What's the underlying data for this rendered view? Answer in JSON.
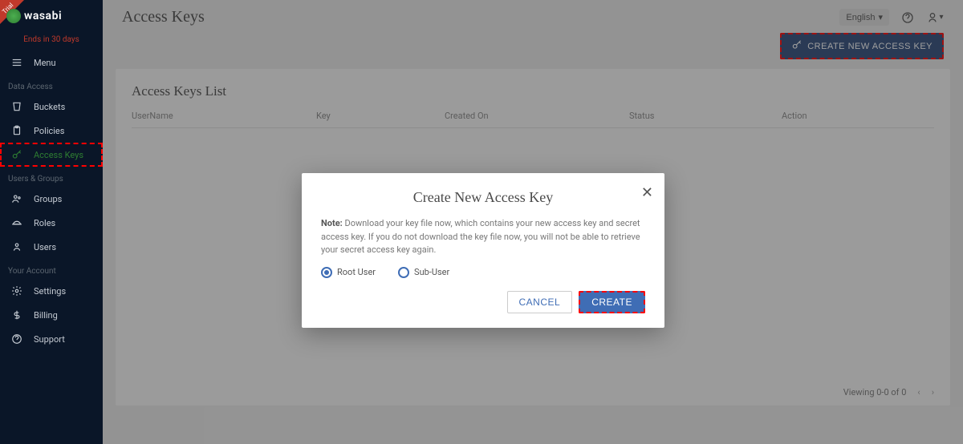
{
  "brand": {
    "name": "wasabi",
    "trial_ribbon": "Trial",
    "trial_ends": "Ends in 30 days"
  },
  "sidebar": {
    "menu_label": "Menu",
    "sections": {
      "data_access": {
        "label": "Data Access",
        "items": [
          {
            "label": "Buckets"
          },
          {
            "label": "Policies"
          },
          {
            "label": "Access Keys"
          }
        ]
      },
      "users_groups": {
        "label": "Users & Groups",
        "items": [
          {
            "label": "Groups"
          },
          {
            "label": "Roles"
          },
          {
            "label": "Users"
          }
        ]
      },
      "your_account": {
        "label": "Your Account",
        "items": [
          {
            "label": "Settings"
          },
          {
            "label": "Billing"
          },
          {
            "label": "Support"
          }
        ]
      }
    }
  },
  "header": {
    "page_title": "Access Keys",
    "language": "English",
    "create_button": "CREATE NEW ACCESS KEY"
  },
  "list": {
    "title": "Access Keys List",
    "columns": [
      "UserName",
      "Key",
      "Created On",
      "Status",
      "Action"
    ],
    "rows": [],
    "pager": {
      "viewing": "Viewing 0-0 of 0"
    }
  },
  "modal": {
    "title": "Create New Access Key",
    "note_label": "Note:",
    "note_text": "Download your key file now, which contains your new access key and secret access key. If you do not download the key file now, you will not be able to retrieve your secret access key again.",
    "radio_root": "Root User",
    "radio_sub": "Sub-User",
    "cancel": "CANCEL",
    "create": "CREATE"
  }
}
